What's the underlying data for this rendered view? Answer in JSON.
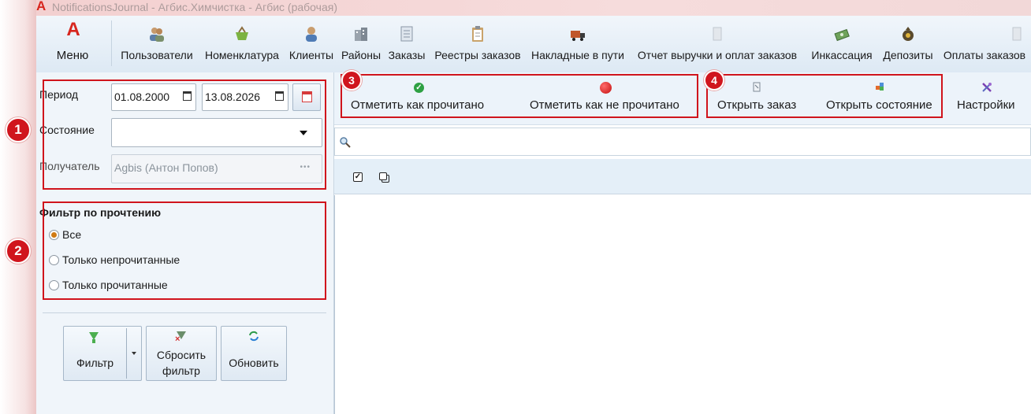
{
  "window": {
    "title": "NotificationsJournal - Агбис.Химчистка - Агбис (рабочая)"
  },
  "ribbon": {
    "menu_label": "Меню",
    "items": [
      {
        "label": "Пользователи",
        "icon": "users-icon"
      },
      {
        "label": "Номенклатура",
        "icon": "basket-icon"
      },
      {
        "label": "Клиенты",
        "icon": "client-icon"
      },
      {
        "label": "Районы",
        "icon": "buildings-icon"
      },
      {
        "label": "Заказы",
        "icon": "orders-document-icon"
      },
      {
        "label": "Реестры заказов",
        "icon": "clipboard-icon"
      },
      {
        "label": "Накладные в пути",
        "icon": "delivery-truck-icon"
      },
      {
        "label": "Отчет выручки и оплат заказов",
        "icon": "report-icon"
      },
      {
        "label": "Инкассация",
        "icon": "cash-icon"
      },
      {
        "label": "Депозиты",
        "icon": "money-bag-icon"
      },
      {
        "label": "Оплаты заказов",
        "icon": "payment-icon"
      }
    ]
  },
  "filters": {
    "period_label": "Период",
    "date_from": "01.08.2000",
    "date_to": "13.08.2026",
    "state_label": "Состояние",
    "state_value": "",
    "recipient_label": "Получатель",
    "recipient_value": "Agbis (Антон Попов)",
    "read_filter_title": "Фильтр по прочтению",
    "read_options": [
      "Все",
      "Только непрочитанные",
      "Только прочитанные"
    ],
    "read_selected": "Все"
  },
  "buttons": {
    "filter": "Фильтр",
    "reset_line1": "Сбросить",
    "reset_line2": "фильтр",
    "refresh": "Обновить"
  },
  "commands": {
    "mark_read": "Отметить как прочитано",
    "mark_unread": "Отметить как не прочитано",
    "open_order": "Открыть заказ",
    "open_state": "Открыть состояние",
    "settings": "Настройки"
  },
  "badges": [
    "1",
    "2",
    "3",
    "4"
  ],
  "colors": {
    "accent_red": "#d0141c",
    "brand_red": "#d7261e",
    "panel_bg": "#f0f5fa",
    "ribbon_bg": "#e8f0f8"
  }
}
